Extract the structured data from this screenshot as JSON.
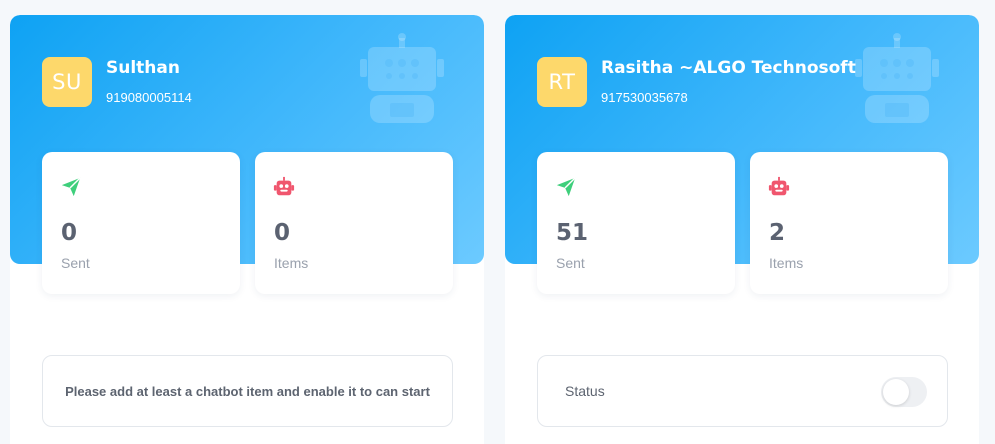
{
  "colors": {
    "hero_gradient_start": "#0ea2f3",
    "hero_gradient_end": "#6ccaff",
    "avatar_bg": "#fdd86b",
    "sent_icon": "#3ecf7b",
    "items_icon": "#f0566e",
    "stat_value": "#5b6271",
    "stat_label": "#9aa1ad"
  },
  "cards": [
    {
      "avatar_initials": "SU",
      "name": "Sulthan",
      "phone": "919080005114",
      "stats": [
        {
          "icon": "send-icon",
          "value": "0",
          "label": "Sent"
        },
        {
          "icon": "robot-icon",
          "value": "0",
          "label": "Items"
        }
      ],
      "notice": "Please add at least a chatbot item and enable it to can start"
    },
    {
      "avatar_initials": "RT",
      "name": "Rasitha ~ALGO Technosoft",
      "phone": "917530035678",
      "stats": [
        {
          "icon": "send-icon",
          "value": "51",
          "label": "Sent"
        },
        {
          "icon": "robot-icon",
          "value": "2",
          "label": "Items"
        }
      ],
      "status_label": "Status",
      "status_enabled": false
    }
  ]
}
